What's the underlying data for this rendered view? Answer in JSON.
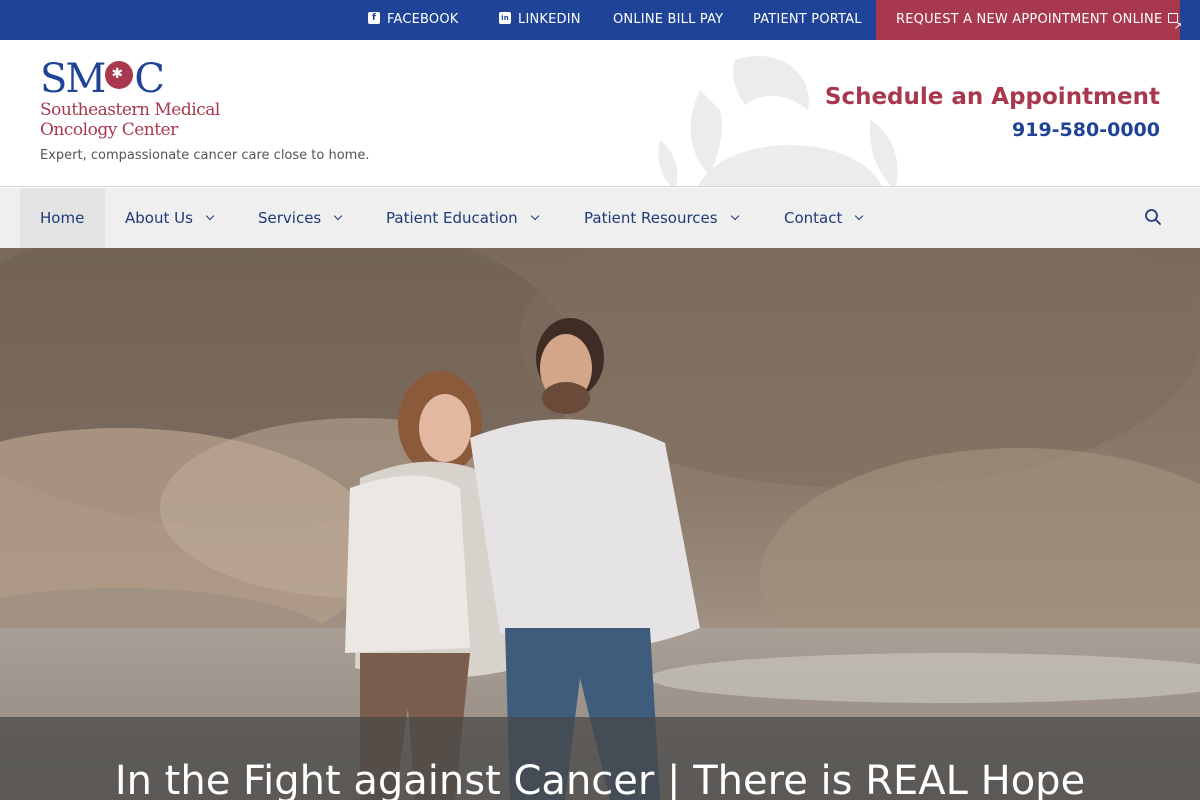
{
  "topbar": {
    "facebook": "FACEBOOK",
    "linkedin": "LINKEDIN",
    "bill_pay": "ONLINE BILL PAY",
    "portal": "PATIENT PORTAL",
    "request": "REQUEST A NEW APPOINTMENT ONLINE"
  },
  "header": {
    "logo_letters": [
      "SM",
      "C"
    ],
    "logo_name_line1": "Southeastern Medical",
    "logo_name_line2": "Oncology Center",
    "tagline": "Expert, compassionate cancer care close to home.",
    "schedule_title": "Schedule an Appointment",
    "phone": "919-580-0000"
  },
  "nav": {
    "items": [
      {
        "label": "Home",
        "dropdown": false,
        "active": true
      },
      {
        "label": "About Us",
        "dropdown": true
      },
      {
        "label": "Services",
        "dropdown": true
      },
      {
        "label": "Patient Education",
        "dropdown": true
      },
      {
        "label": "Patient Resources",
        "dropdown": true
      },
      {
        "label": "Contact",
        "dropdown": true
      }
    ]
  },
  "hero": {
    "title": "In the Fight against Cancer | There is REAL Hope"
  },
  "colors": {
    "brand_blue": "#1f4396",
    "brand_red": "#a8384d",
    "nav_bg": "#efefef",
    "icons": [
      "facebook-icon",
      "linkedin-icon",
      "external-link-icon",
      "search-icon",
      "chevron-down-icon",
      "crab-icon"
    ]
  }
}
